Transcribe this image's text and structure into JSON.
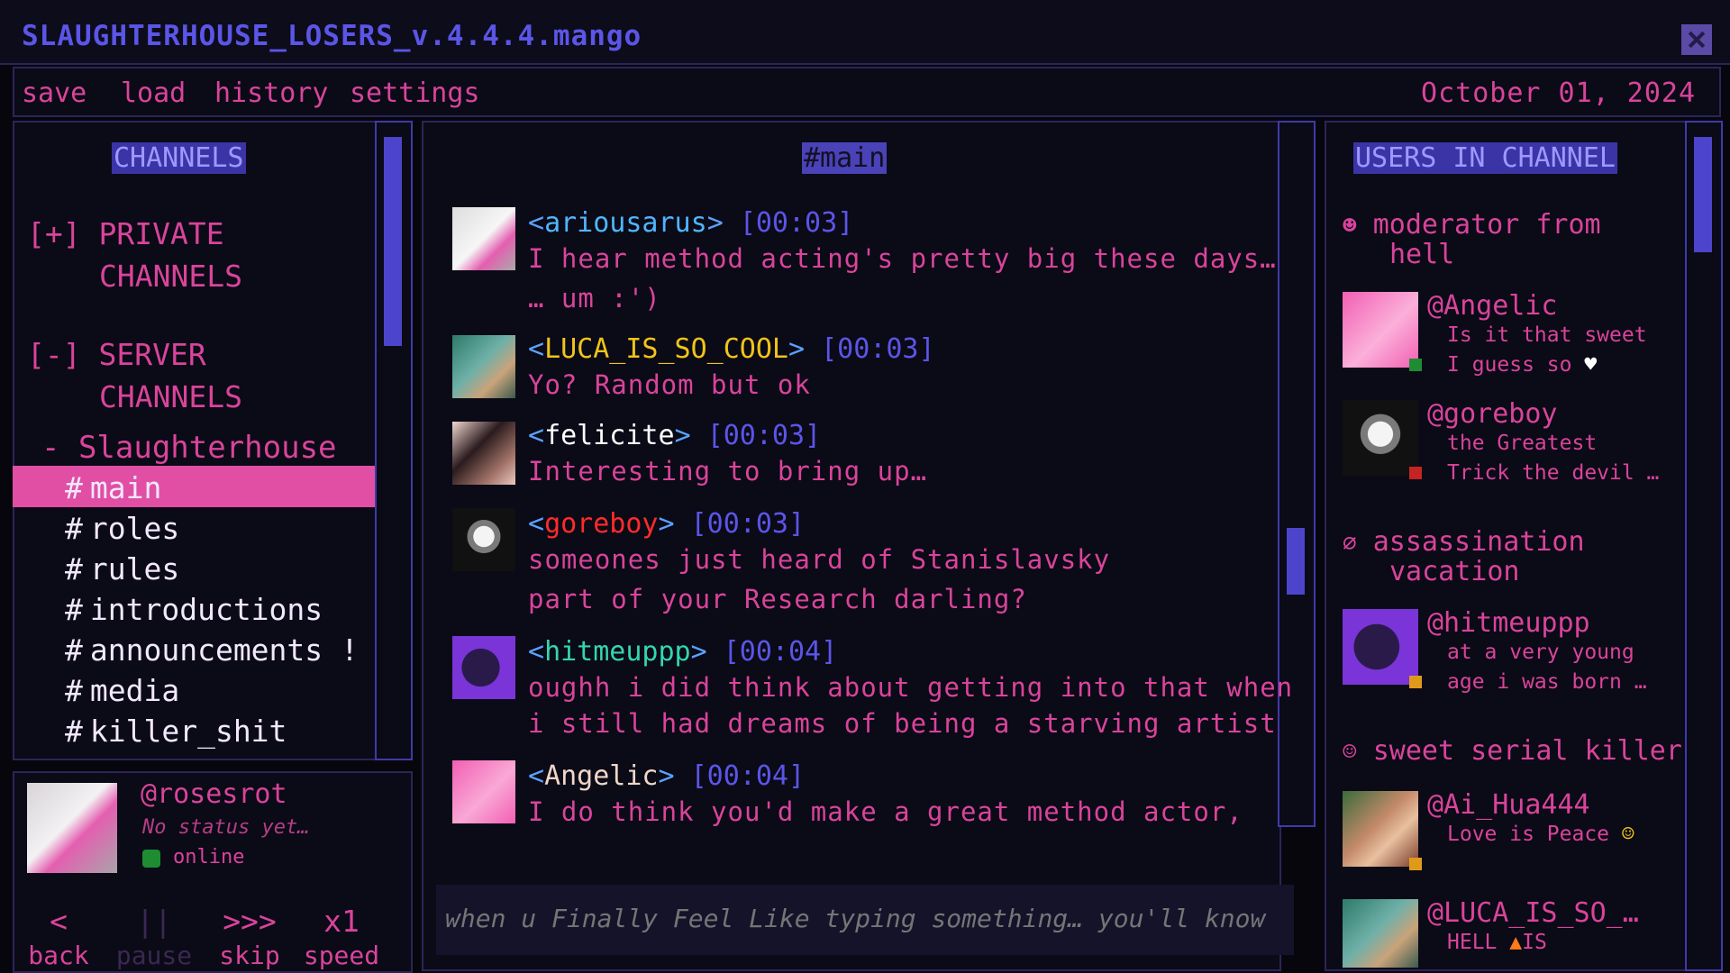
{
  "window": {
    "title": "SLAUGHTERHOUSE_LOSERS_v.4.4.4.mango",
    "close_icon": "close-icon"
  },
  "menu": {
    "items": [
      "save",
      "load",
      "history",
      "settings"
    ],
    "date": "October 01, 2024"
  },
  "channels": {
    "heading": "CHANNELS",
    "private": {
      "toggle": "[+]",
      "line1": "PRIVATE",
      "line2": "CHANNELS"
    },
    "server": {
      "toggle": "[-]",
      "line1": "SERVER",
      "line2": "CHANNELS"
    },
    "server_name": "- Slaughterhouse",
    "list": [
      {
        "name": "main",
        "selected": true
      },
      {
        "name": "roles"
      },
      {
        "name": "rules"
      },
      {
        "name": "introductions"
      },
      {
        "name": "announcements",
        "badge": "!"
      },
      {
        "name": "media"
      },
      {
        "name": "killer_shit"
      }
    ]
  },
  "profile": {
    "handle": "@rosesrot",
    "status": "No status yet…",
    "presence": "online"
  },
  "controls": [
    {
      "icon": "<",
      "label": "back"
    },
    {
      "icon": "||",
      "label": "pause"
    },
    {
      "icon": ">>>",
      "label": "skip"
    },
    {
      "icon": "x1",
      "label": "speed"
    }
  ],
  "chat": {
    "heading": "#main",
    "messages": [
      {
        "user": "ariousarus",
        "time": "[00:03]",
        "color": "#4fb6ff",
        "lines": [
          "I hear method acting's pretty big these days…",
          "… um :')"
        ]
      },
      {
        "user": "LUCA_IS_SO_COOL",
        "time": "[00:03]",
        "color": "#f0c419",
        "lines": [
          "Yo? Random but ok"
        ]
      },
      {
        "user": "felicite",
        "time": "[00:03]",
        "color": "#ffffff",
        "lines": [
          "Interesting to bring up…"
        ]
      },
      {
        "user": "goreboy",
        "time": "[00:03]",
        "color": "#ff2b2b",
        "lines": [
          "someones just heard of Stanislavsky",
          "part of your Research darling?"
        ]
      },
      {
        "user": "hitmeuppp",
        "time": "[00:04]",
        "color": "#33d6b0",
        "lines": [
          "oughh i did think about getting into that when",
          "i still had dreams of being a starving artist"
        ]
      },
      {
        "user": "Angelic",
        "time": "[00:04]",
        "color": "#f0d6c8",
        "lines": [
          "I do think you'd make a great method actor,"
        ]
      }
    ],
    "composer_placeholder": "when u Finally Feel Like typing something… you'll know"
  },
  "users": {
    "heading": "USERS IN CHANNEL",
    "groups": [
      {
        "role": "moderator from hell",
        "role_line1": "moderator from",
        "role_line2": "hell",
        "icon": "devil-icon",
        "members": [
          {
            "name": "@Angelic",
            "status1": "Is it that sweet",
            "status2": "I guess so",
            "presence": "#1e8c33"
          },
          {
            "name": "@goreboy",
            "status1": "the Greatest",
            "status2": "Trick the devil …",
            "presence": "#c42424"
          }
        ]
      },
      {
        "role": "assassination vacation",
        "role_line1": "assassination",
        "role_line2": "vacation",
        "icon": "empty-set-icon",
        "members": [
          {
            "name": "@hitmeuppp",
            "status1": "at a very young",
            "status2": "age i was born …",
            "presence": "#e09a1a"
          }
        ]
      },
      {
        "role": "sweet serial killer",
        "icon": "smiley-icon",
        "members": [
          {
            "name": "@Ai_Hua444",
            "status1": "Love is Peace",
            "presence": "#e09a1a"
          },
          {
            "name": "@LUCA_IS_SO_…",
            "status1": "HELL",
            "status1b": "IS"
          }
        ]
      }
    ]
  },
  "colors": {
    "accent": "#e14fa4",
    "heading_bg": "#4a42b8",
    "border": "#2b2558",
    "bg": "#07060d"
  }
}
